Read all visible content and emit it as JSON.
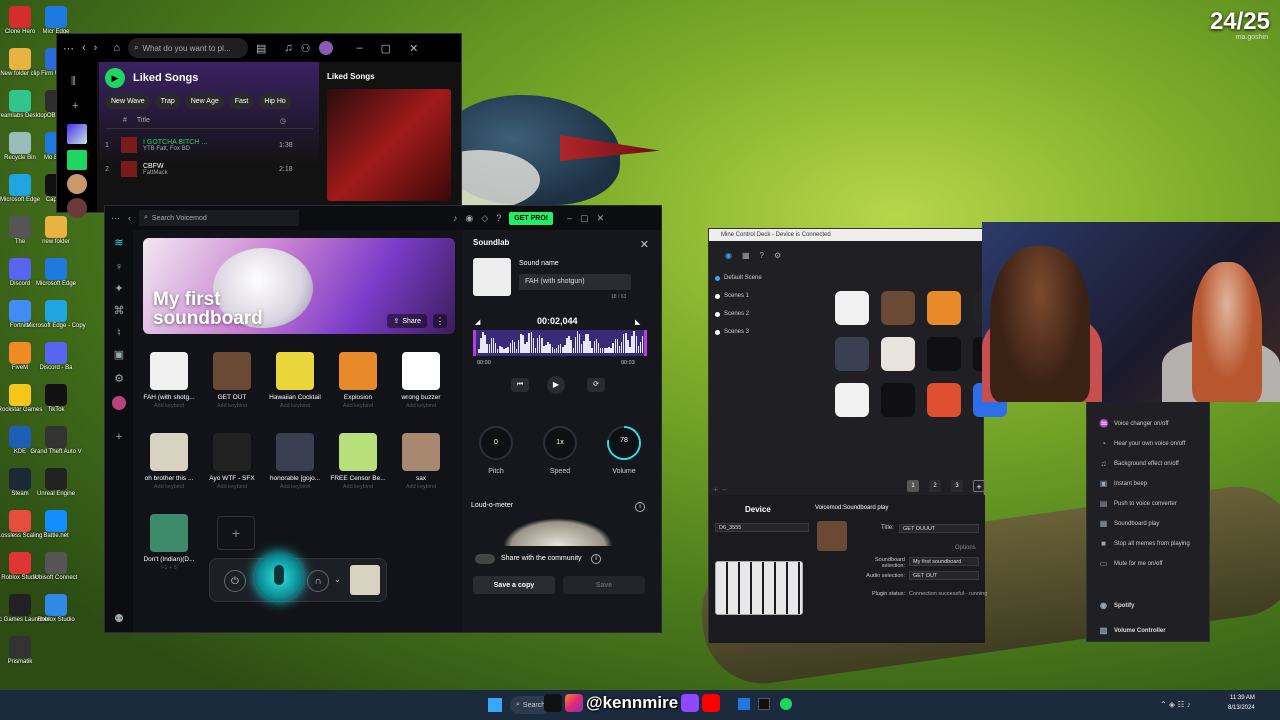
{
  "overlay": {
    "counter": "24/25",
    "counter_sub": "ma.goshin",
    "handle": "@kennmire"
  },
  "desktop_icons": [
    {
      "label": "Clone Hero",
      "color": "#d32d2d"
    },
    {
      "label": "Micr Edge",
      "color": "#1f7ae0"
    },
    {
      "label": "New folder clip",
      "color": "#e8b340"
    },
    {
      "label": "Firm Updat",
      "color": "#2a6bd9"
    },
    {
      "label": "Streamlabs Desktop",
      "color": "#31c48d"
    },
    {
      "label": "OBS S",
      "color": "#2e2e2e"
    },
    {
      "label": "Recycle Bin",
      "color": "#9bb"
    },
    {
      "label": "Mo Edge",
      "color": "#1f7ae0"
    },
    {
      "label": "Microsoft Edge",
      "color": "#1fa6e0"
    },
    {
      "label": "CapCut",
      "color": "#111"
    },
    {
      "label": "The",
      "color": "#555"
    },
    {
      "label": "new folder",
      "color": "#e8b340"
    },
    {
      "label": "Discord",
      "color": "#5865f2"
    },
    {
      "label": "Microsoft Edge",
      "color": "#1f7ae0"
    },
    {
      "label": "Fortnite",
      "color": "#3f8cf7"
    },
    {
      "label": "Microsoft Edge - Copy",
      "color": "#1fa6e0"
    },
    {
      "label": "FiveM",
      "color": "#f08a25"
    },
    {
      "label": "Discord - Ba",
      "color": "#5865f2"
    },
    {
      "label": "Rockstar Games",
      "color": "#f5c518"
    },
    {
      "label": "TikTok",
      "color": "#111"
    },
    {
      "label": "KDE",
      "color": "#1c5fb5"
    },
    {
      "label": "Grand Theft Auto V",
      "color": "#333"
    },
    {
      "label": "Steam",
      "color": "#1b2838"
    },
    {
      "label": "Unreal Engine",
      "color": "#222"
    },
    {
      "label": "Lossless Scaling",
      "color": "#e94d3e"
    },
    {
      "label": "Battle.net",
      "color": "#148eff"
    },
    {
      "label": "Roblox Studio",
      "color": "#e13535"
    },
    {
      "label": "Ubisoft Connect",
      "color": "#555"
    },
    {
      "label": "Epic Games Launcher",
      "color": "#222"
    },
    {
      "label": "Roblox Studio",
      "color": "#2e8ae6"
    },
    {
      "label": "Prismatik",
      "color": "#333"
    }
  ],
  "spotify": {
    "search_placeholder": "What do you want to pl...",
    "title": "Liked Songs",
    "right_title": "Liked Songs",
    "chips": [
      "New Wave",
      "Trap",
      "New Age",
      "Fast",
      "Hip Ho"
    ],
    "col_num": "#",
    "col_title": "Title",
    "tracks": [
      {
        "num": "1",
        "title": "I GOTCHA BITCH ...",
        "artist": "YTB Fatt, Fox BD",
        "duration": "1:38"
      },
      {
        "num": "2",
        "title": "CBFW",
        "artist": "FattMack",
        "duration": "2:18"
      }
    ]
  },
  "voicemod": {
    "search_placeholder": "Search Voicemod",
    "get_pro": "GET PRO!",
    "hero_title_1": "My first",
    "hero_title_2": "soundboard",
    "share": "Share",
    "sounds": [
      {
        "name": "FAH (with shotg...",
        "keybind": "Add keybind",
        "color": "#f0f0f0"
      },
      {
        "name": "GET OUT",
        "keybind": "Add keybind",
        "color": "#6b4a35"
      },
      {
        "name": "Hawaiian Cocktail",
        "keybind": "Add keybind",
        "color": "#e8d63a"
      },
      {
        "name": "Explosion",
        "keybind": "Add keybind",
        "color": "#e88a2a"
      },
      {
        "name": "wrong buzzer",
        "keybind": "Add keybind",
        "color": "#fff"
      },
      {
        "name": "oh brother this ...",
        "keybind": "Add keybind",
        "color": "#d8d2c0"
      },
      {
        "name": "Ayo WTF - SFX",
        "keybind": "Add keybind",
        "color": "#222"
      },
      {
        "name": "honorable [gojo...",
        "keybind": "Add keybind",
        "color": "#3a3f52"
      },
      {
        "name": "FREE Censor Be...",
        "keybind": "Add keybind",
        "color": "#b7e07a"
      },
      {
        "name": "sax",
        "keybind": "Add keybind",
        "color": "#a88870"
      },
      {
        "name": "Don't (Indian)(D...",
        "keybind": "F2 + 5",
        "color": "#3e8b6c"
      }
    ],
    "soundlab": {
      "title": "Soundlab",
      "sound_name_label": "Sound name",
      "sound_name_value": "FAH (with shotgun)",
      "char_count": "18 / 63",
      "time": "00:02,044",
      "start": "00:00",
      "end": "00:03",
      "pitch_value": "0",
      "pitch_label": "Pitch",
      "speed_value": "1x",
      "speed_label": "Speed",
      "volume_value": "78",
      "volume_label": "Volume",
      "volume_level": 0.78,
      "loud_label": "Loud-o-meter",
      "community_label": "Share with the community",
      "save_copy": "Save a copy",
      "save": "Save"
    }
  },
  "deck": {
    "title": "Mine Control Deck - Device is Connected",
    "scenes": [
      "Default Scene",
      "Scenes 1",
      "Scenes 2",
      "Scenes 3"
    ],
    "pages": [
      "1",
      "2",
      "3"
    ],
    "device_label": "Device",
    "device_value": "D6_3555",
    "action_title": "Voicemod:Soundboard play",
    "title_label": "Title:",
    "title_value": "GET OUUUT",
    "options_label": "Options",
    "soundboard_label": "Soundboard selection:",
    "soundboard_value": "My first soundboard",
    "audio_label": "Audio selection:",
    "audio_value": "GET OUT",
    "plugin_label": "Plugin status:",
    "plugin_value": "Connection successful - running"
  },
  "actions": [
    {
      "label": "Voice changer on/off",
      "icon": "voice-icon"
    },
    {
      "label": "Hear your own voice on/off",
      "icon": "ear-icon"
    },
    {
      "label": "Background effect on/off",
      "icon": "music-icon"
    },
    {
      "label": "Instant beep",
      "icon": "beep-icon"
    },
    {
      "label": "Push to voice converter",
      "icon": "push-icon"
    },
    {
      "label": "Soundboard play",
      "icon": "soundboard-icon"
    },
    {
      "label": "Stop all memes from playing",
      "icon": "stop-icon"
    },
    {
      "label": "Mute for me on/off",
      "icon": "mute-icon"
    },
    {
      "label": "Spotify",
      "icon": "spotify-icon"
    },
    {
      "label": "Volume Controller",
      "icon": "volume-icon"
    }
  ],
  "taskbar": {
    "search": "Search",
    "time": "11:39 AM",
    "date": "8/13/2024"
  }
}
